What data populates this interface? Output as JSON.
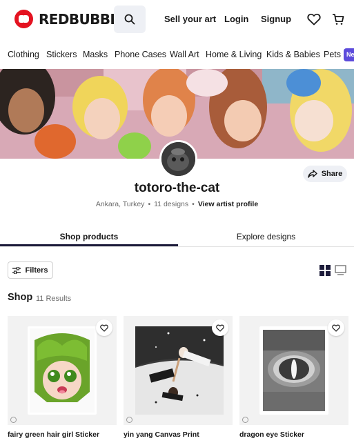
{
  "header": {
    "logo_text": "REDBUBBLE",
    "sell_label": "Sell your art",
    "login_label": "Login",
    "signup_label": "Signup"
  },
  "nav": {
    "items": [
      "Clothing",
      "Stickers",
      "Masks",
      "Phone Cases",
      "Wall Art",
      "Home & Living",
      "Kids & Babies",
      "Pets"
    ],
    "badge": "Ne"
  },
  "artist": {
    "name": "totoro-the-cat",
    "location": "Ankara, Turkey",
    "designs": "11 designs",
    "profile_link": "View artist profile",
    "share_label": "Share"
  },
  "tabs": [
    "Shop products",
    "Explore designs"
  ],
  "toolbar": {
    "filters_label": "Filters"
  },
  "shop": {
    "title": "Shop",
    "count": "11 Results"
  },
  "products": [
    {
      "title": "fairy green hair girl Sticker"
    },
    {
      "title": "yin yang Canvas Print"
    },
    {
      "title": "dragon eye Sticker"
    }
  ],
  "colors": {
    "brand_red": "#e41321",
    "accent_navy": "#1c1b3a",
    "badge_purple": "#5c4bdb"
  }
}
